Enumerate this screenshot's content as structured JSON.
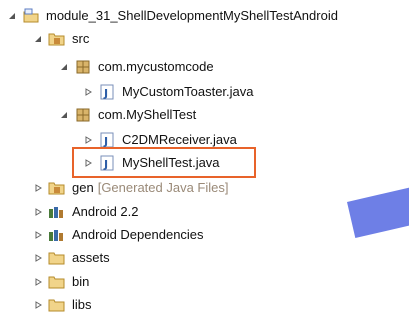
{
  "tree": {
    "project": "module_31_ShellDevelopmentMyShellTestAndroid",
    "src": "src",
    "pkg1": "com.mycustomcode",
    "pkg1_file": "MyCustomToaster.java",
    "pkg2": "com.MyShellTest",
    "pkg2_file1": "C2DMReceiver.java",
    "pkg2_file2": "MyShellTest.java",
    "gen": "gen",
    "gen_suffix": "[Generated Java Files]",
    "android_lib": "Android 2.2",
    "android_deps": "Android Dependencies",
    "assets": "assets",
    "bin": "bin",
    "libs": "libs"
  },
  "icons": {
    "project": "android-project-icon",
    "src": "source-folder-icon",
    "package": "package-icon",
    "java": "java-file-icon",
    "gen": "generated-folder-icon",
    "library": "library-icon",
    "folder": "folder-icon"
  },
  "colors": {
    "highlight": "#e8632a",
    "overlay_shape": "#6e7fe6"
  }
}
